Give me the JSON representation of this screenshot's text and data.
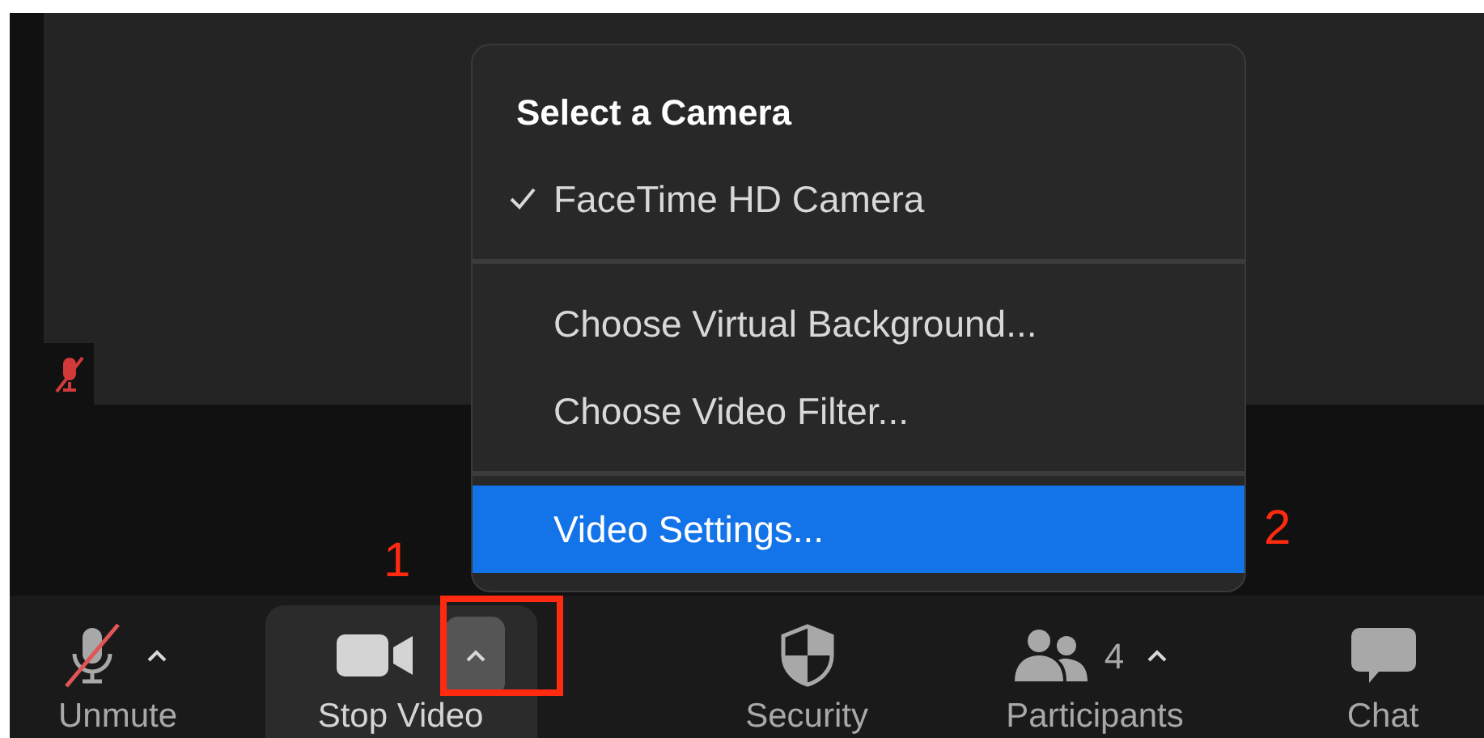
{
  "video_tile": {
    "muted": true
  },
  "menu": {
    "heading": "Select a Camera",
    "sections": [
      [
        {
          "label": "FaceTime HD Camera",
          "checked": true,
          "selected": false
        }
      ],
      [
        {
          "label": "Choose Virtual Background...",
          "checked": false,
          "selected": false
        },
        {
          "label": "Choose Video Filter...",
          "checked": false,
          "selected": false
        }
      ],
      [
        {
          "label": "Video Settings...",
          "checked": false,
          "selected": true
        }
      ]
    ]
  },
  "toolbar": [
    {
      "kind": "mic",
      "label": "Unmute",
      "muted": true,
      "caret": true,
      "active": false
    },
    {
      "kind": "video",
      "label": "Stop Video",
      "caret": true,
      "active": true
    },
    {
      "kind": "security",
      "label": "Security",
      "caret": false,
      "active": false
    },
    {
      "kind": "participants",
      "label": "Participants",
      "count": "4",
      "caret": true,
      "active": false
    },
    {
      "kind": "chat",
      "label": "Chat",
      "caret": false,
      "active": false
    }
  ],
  "annotations": [
    "1",
    "2"
  ]
}
